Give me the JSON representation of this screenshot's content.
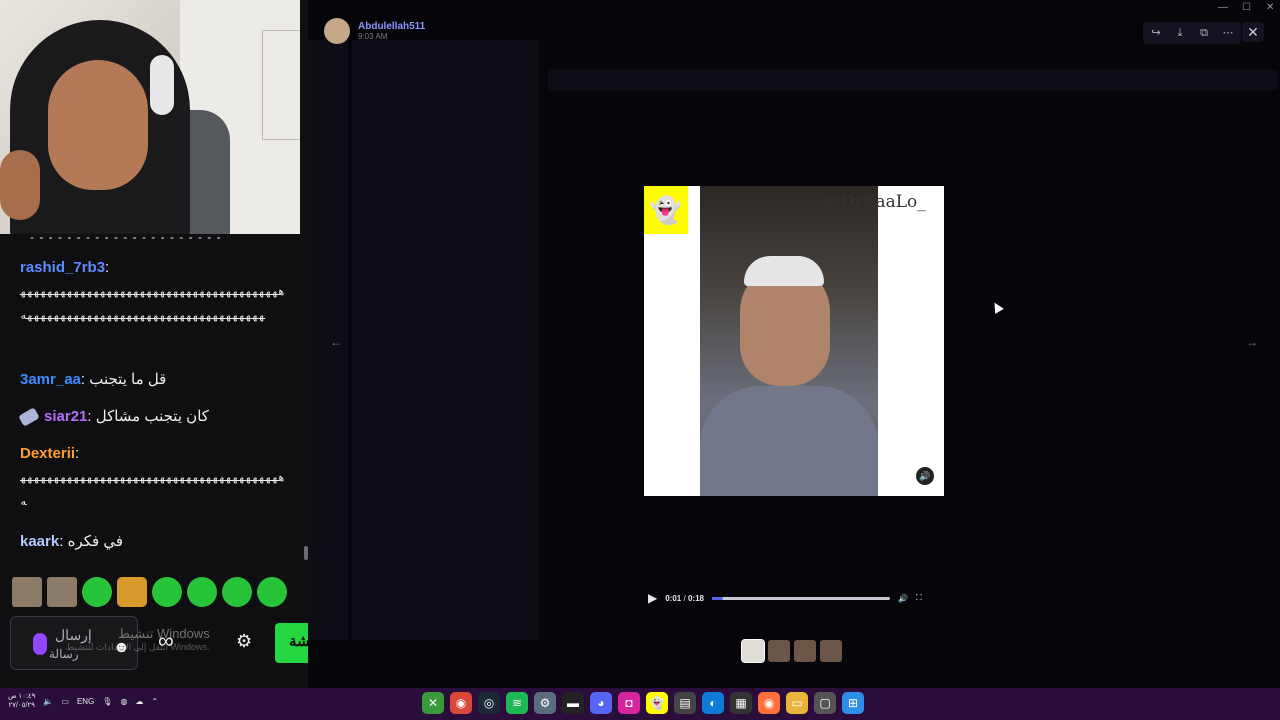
{
  "stream": {
    "chat": {
      "divider": "- - - - - - - - - - - - - - - - - - - - -",
      "messages": [
        {
          "user": "rashid_7rb3",
          "color": "#5b8cff",
          "text": "ههههههههههههههههههههههههههههههههههههههههههههههههههههههههههههههههههههههههههههه"
        },
        {
          "user": "3amr_aa",
          "color": "#3d8cff",
          "text": "قل ما يتجنب"
        },
        {
          "user": "siar21",
          "color": "#b56cff",
          "text": "كان يتجنب مشاكل"
        },
        {
          "user": "Dexterii",
          "color": "#ff9d2e",
          "text": "ههههههههههههههههههههههههههههههههههههههههه"
        },
        {
          "user": "kaark",
          "color": "#b4c7ff",
          "text": "في فكره"
        }
      ],
      "emotes": [
        "photo-emote",
        "photo-emote",
        "green-blob-emote",
        "box-emote",
        "green-blob-emote",
        "green-blob-emote",
        "green-blob-emote",
        "green-blob-emote"
      ],
      "input_placeholder_line1": "إرسال",
      "input_placeholder_line2": "رسالة",
      "chat_button": "شة",
      "watermark_title": "تنشيط Windows",
      "watermark_sub": "انتقل إلى الإعدادات لتنشيط Windows."
    }
  },
  "viewer": {
    "uploader_name": "Abdulellah511",
    "uploader_time": "9:03 AM",
    "toolbar_icons": [
      "forward-icon",
      "download-icon",
      "open-icon",
      "more-icon"
    ],
    "overlay_handle": "@DrKaaLo_",
    "video": {
      "current": "0:01",
      "duration": "0:18",
      "separator": "/",
      "progress_fraction": 0.06
    },
    "thumbnails": 4,
    "selected_thumbnail": 0,
    "accent": "#5865f2"
  },
  "taskbar": {
    "language": "ENG",
    "clock_time": "١٠:٤٩ ص",
    "clock_date": "٢٧/٠٥/٢٩",
    "apps": [
      "xbox",
      "chrome",
      "steam",
      "spotify",
      "settings",
      "terminal",
      "discord",
      "instagram",
      "snapchat",
      "files-app",
      "edge",
      "calendar",
      "firefox",
      "folder",
      "window",
      "windows-start"
    ]
  }
}
